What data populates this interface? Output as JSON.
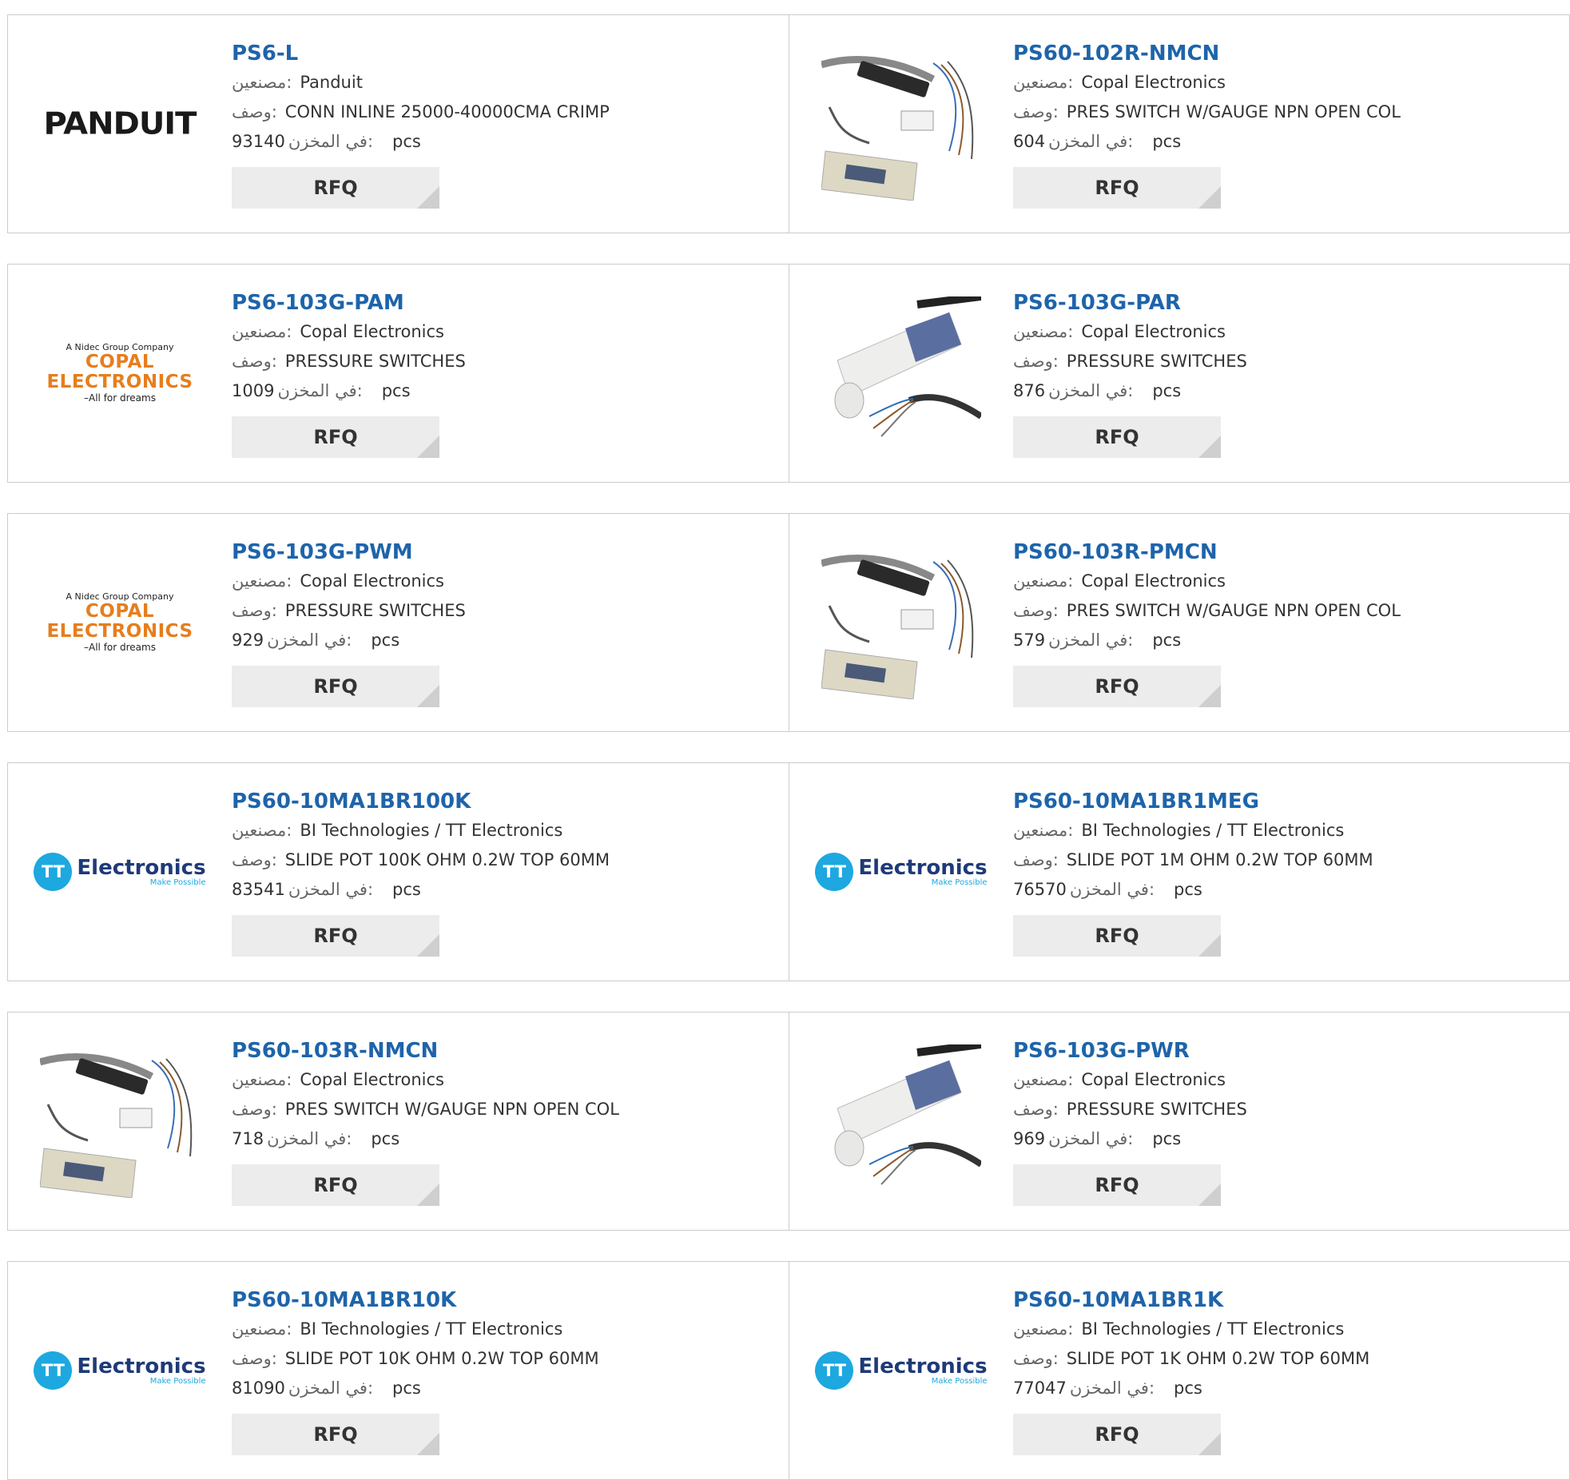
{
  "labels": {
    "manufacturer": "مصنعين:",
    "description": "وصف:",
    "stock": "في المخزن:",
    "unit": "pcs",
    "rfq": "RFQ"
  },
  "rows": [
    [
      {
        "part": "PS6-L",
        "mfr": "Panduit",
        "desc": "CONN INLINE 25000-40000CMA CRIMP",
        "stock": "93140",
        "image": "panduit-logo"
      },
      {
        "part": "PS60-102R-NMCN",
        "mfr": "Copal Electronics",
        "desc": "PRES SWITCH W/GAUGE NPN OPEN COL",
        "stock": "604",
        "image": "pressure-switch-gauge-photo"
      }
    ],
    [
      {
        "part": "PS6-103G-PAM",
        "mfr": "Copal Electronics",
        "desc": "PRESSURE SWITCHES",
        "stock": "1009",
        "image": "copal-logo"
      },
      {
        "part": "PS6-103G-PAR",
        "mfr": "Copal Electronics",
        "desc": "PRESSURE SWITCHES",
        "stock": "876",
        "image": "pressure-switch-photo"
      }
    ],
    [
      {
        "part": "PS6-103G-PWM",
        "mfr": "Copal Electronics",
        "desc": "PRESSURE SWITCHES",
        "stock": "929",
        "image": "copal-logo"
      },
      {
        "part": "PS60-103R-PMCN",
        "mfr": "Copal Electronics",
        "desc": "PRES SWITCH W/GAUGE NPN OPEN COL",
        "stock": "579",
        "image": "pressure-switch-gauge-photo"
      }
    ],
    [
      {
        "part": "PS60-10MA1BR100K",
        "mfr": "BI Technologies / TT Electronics",
        "desc": "SLIDE POT 100K OHM 0.2W TOP 60MM",
        "stock": "83541",
        "image": "tt-electronics-logo"
      },
      {
        "part": "PS60-10MA1BR1MEG",
        "mfr": "BI Technologies / TT Electronics",
        "desc": "SLIDE POT 1M OHM 0.2W TOP 60MM",
        "stock": "76570",
        "image": "tt-electronics-logo"
      }
    ],
    [
      {
        "part": "PS60-103R-NMCN",
        "mfr": "Copal Electronics",
        "desc": "PRES SWITCH W/GAUGE NPN OPEN COL",
        "stock": "718",
        "image": "pressure-switch-gauge-photo"
      },
      {
        "part": "PS6-103G-PWR",
        "mfr": "Copal Electronics",
        "desc": "PRESSURE SWITCHES",
        "stock": "969",
        "image": "pressure-switch-photo"
      }
    ],
    [
      {
        "part": "PS60-10MA1BR10K",
        "mfr": "BI Technologies / TT Electronics",
        "desc": "SLIDE POT 10K OHM 0.2W TOP 60MM",
        "stock": "81090",
        "image": "tt-electronics-logo"
      },
      {
        "part": "PS60-10MA1BR1K",
        "mfr": "BI Technologies / TT Electronics",
        "desc": "SLIDE POT 1K OHM 0.2W TOP 60MM",
        "stock": "77047",
        "image": "tt-electronics-logo"
      }
    ]
  ],
  "logos": {
    "panduit": "PANDUIT",
    "copal_group": "A Nidec Group Company",
    "copal_main": "COPAL ELECTRONICS",
    "copal_tag": "–All for dreams",
    "tt_mark": "TT",
    "tt_word": "Electronics",
    "tt_tag": "Make Possible"
  }
}
